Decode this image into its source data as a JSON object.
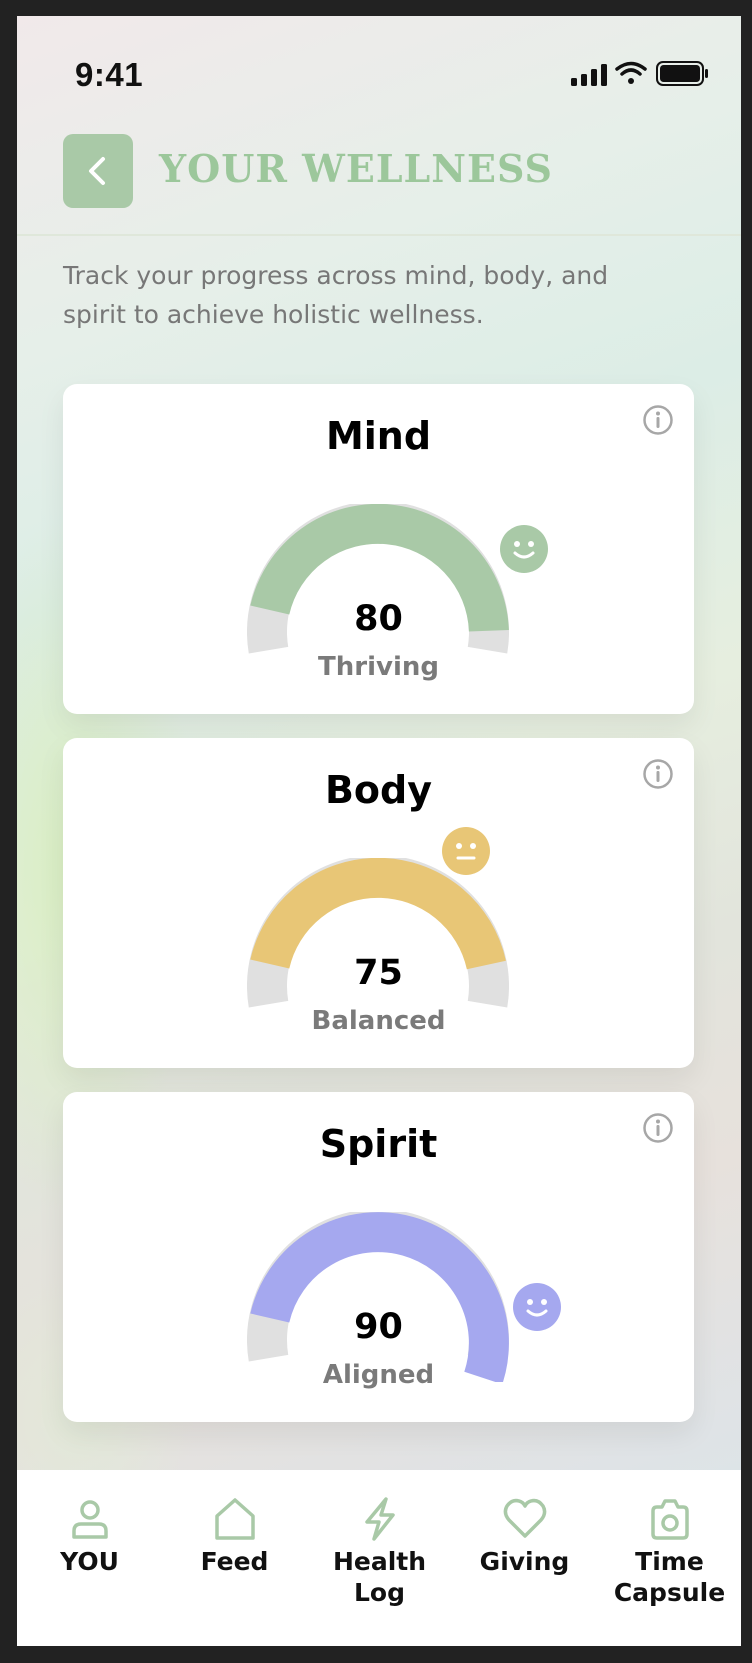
{
  "status_bar": {
    "time": "9:41"
  },
  "header": {
    "title": "YOUR WELLNESS"
  },
  "intro": "Track your progress across mind, body, and spirit to achieve holistic wellness.",
  "colors": {
    "accent_green": "#a9c9a7",
    "mind": "#a9c9a7",
    "body": "#e8c676",
    "spirit": "#a5a8ef",
    "track": "#e0e0e0"
  },
  "cards": [
    {
      "title": "Mind",
      "score": "80",
      "status": "Thriving",
      "score_fraction": 0.8,
      "mood_icon": "smile-icon"
    },
    {
      "title": "Body",
      "score": "75",
      "status": "Balanced",
      "score_fraction": 0.75,
      "mood_icon": "neutral-face-icon"
    },
    {
      "title": "Spirit",
      "score": "90",
      "status": "Aligned",
      "score_fraction": 0.9,
      "mood_icon": "smile-icon"
    }
  ],
  "nav": [
    {
      "label": "YOU",
      "icon": "person-icon"
    },
    {
      "label": "Feed",
      "icon": "home-icon"
    },
    {
      "label": "Health Log",
      "icon": "lightning-icon"
    },
    {
      "label": "Giving",
      "icon": "heart-icon"
    },
    {
      "label": "Time Capsule",
      "icon": "camera-icon"
    }
  ]
}
